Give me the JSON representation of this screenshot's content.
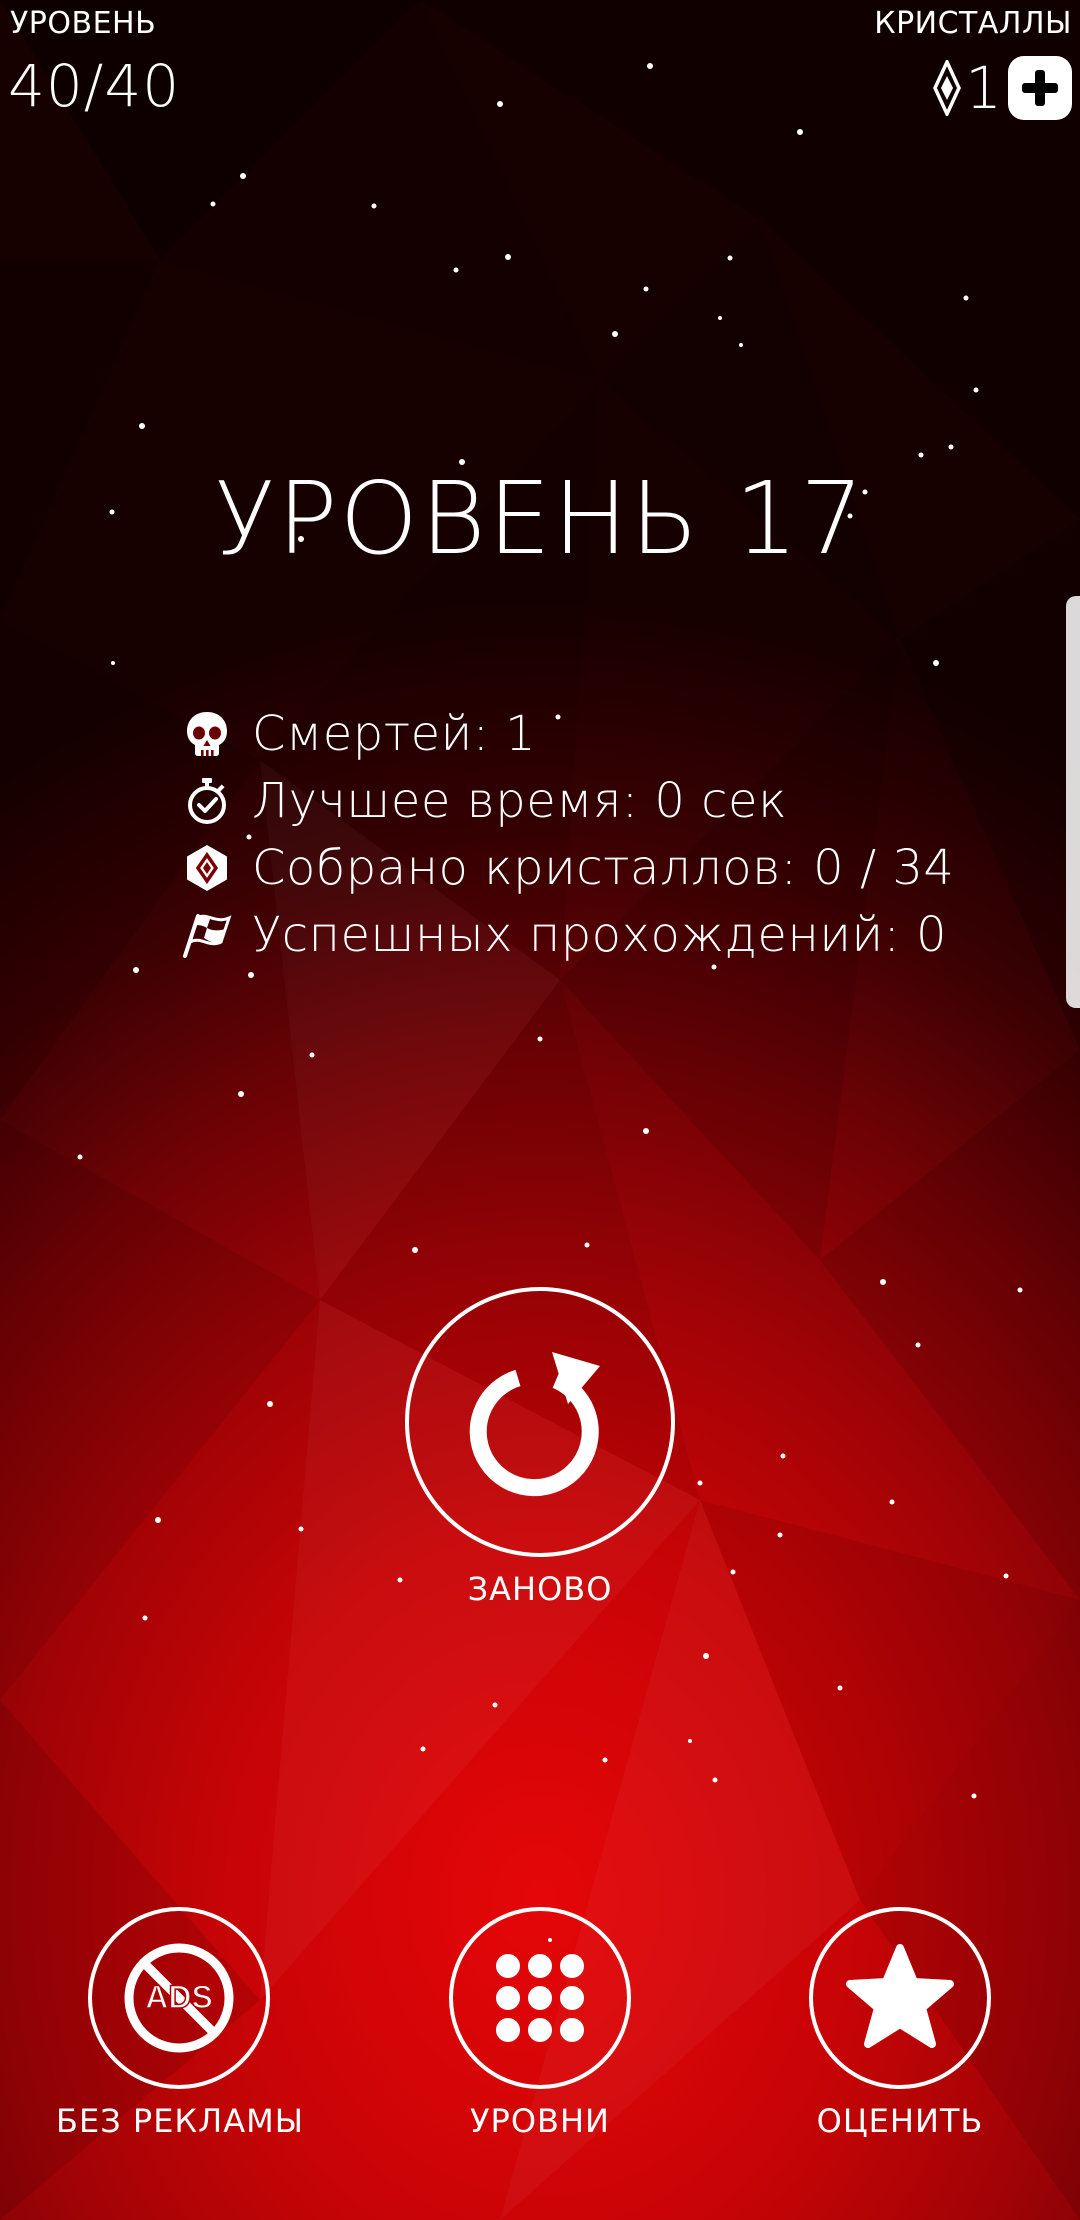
{
  "hud": {
    "level_label": "УРОВЕНЬ",
    "level_progress": "40/40",
    "crystals_label": "КРИСТАЛЛЫ",
    "crystal_count": "1"
  },
  "title": "УРОВЕНЬ 17",
  "stats": [
    {
      "icon": "skull-icon",
      "text": "Смертей: 1"
    },
    {
      "icon": "stopwatch-icon",
      "text": "Лучшее время: 0 сек"
    },
    {
      "icon": "crystal-icon",
      "text": "Собрано кристаллов: 0 / 34"
    },
    {
      "icon": "checkered-flag-icon",
      "text": "Успешных прохождений: 0"
    }
  ],
  "retry": {
    "label": "ЗАНОВО",
    "icon": "retry-arrow-icon"
  },
  "bottom": {
    "no_ads": {
      "label": "БЕЗ РЕКЛАМЫ",
      "icon": "no-ads-icon",
      "icon_text": "ADS"
    },
    "levels": {
      "label": "УРОВНИ",
      "icon": "grid-dots-icon"
    },
    "rate": {
      "label": "ОЦЕНИТЬ",
      "icon": "star-icon"
    }
  },
  "colors": {
    "background_top": "#170000",
    "background_bottom": "#e50608",
    "foreground": "#ffffff"
  }
}
